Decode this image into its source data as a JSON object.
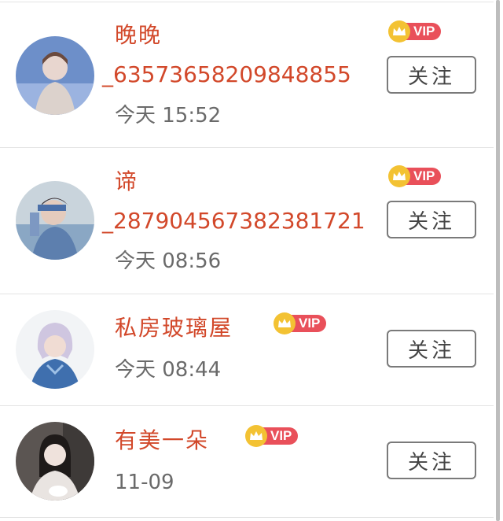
{
  "users": [
    {
      "name": "晚晚",
      "uid": "_63573658209848855",
      "time": "今天 15:52",
      "vip_label": "VIP",
      "follow_label": "关注"
    },
    {
      "name": "谛",
      "uid": "_287904567382381721",
      "time": "今天 08:56",
      "vip_label": "VIP",
      "follow_label": "关注"
    },
    {
      "name": "私房玻璃屋",
      "time": "今天 08:44",
      "vip_label": "VIP",
      "follow_label": "关注"
    },
    {
      "name": "有美一朵",
      "time": "11-09",
      "vip_label": "VIP",
      "follow_label": "关注"
    }
  ],
  "colors": {
    "name": "#d2482a",
    "vip_tag": "#e9505a",
    "vip_crown": "#f3c233",
    "time": "#6a6a6a"
  }
}
